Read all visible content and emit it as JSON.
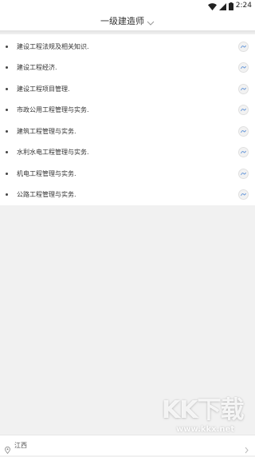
{
  "status_bar": {
    "time": "2:24",
    "icons": [
      "wifi-icon",
      "signal-icon",
      "battery-icon"
    ]
  },
  "header": {
    "title": "一级建造师",
    "dropdown_icon": "chevron-down-icon"
  },
  "subjects": [
    {
      "label": "建设工程法规及相关知识."
    },
    {
      "label": "建设工程经济."
    },
    {
      "label": "建设工程项目管理."
    },
    {
      "label": "市政公用工程管理与实务."
    },
    {
      "label": "建筑工程管理与实务."
    },
    {
      "label": "水利水电工程管理与实务."
    },
    {
      "label": "机电工程管理与实务."
    },
    {
      "label": "公路工程管理与实务."
    }
  ],
  "footer": {
    "location_icon": "location-pin-icon",
    "location": "江西",
    "chevron_icon": "chevron-right-icon"
  },
  "watermark": {
    "title": "KK下载",
    "url": "www.kkx.net"
  },
  "colors": {
    "background": "#f1f1f1",
    "surface": "#ffffff",
    "text": "#333333",
    "accent": "#5a8fd6"
  }
}
